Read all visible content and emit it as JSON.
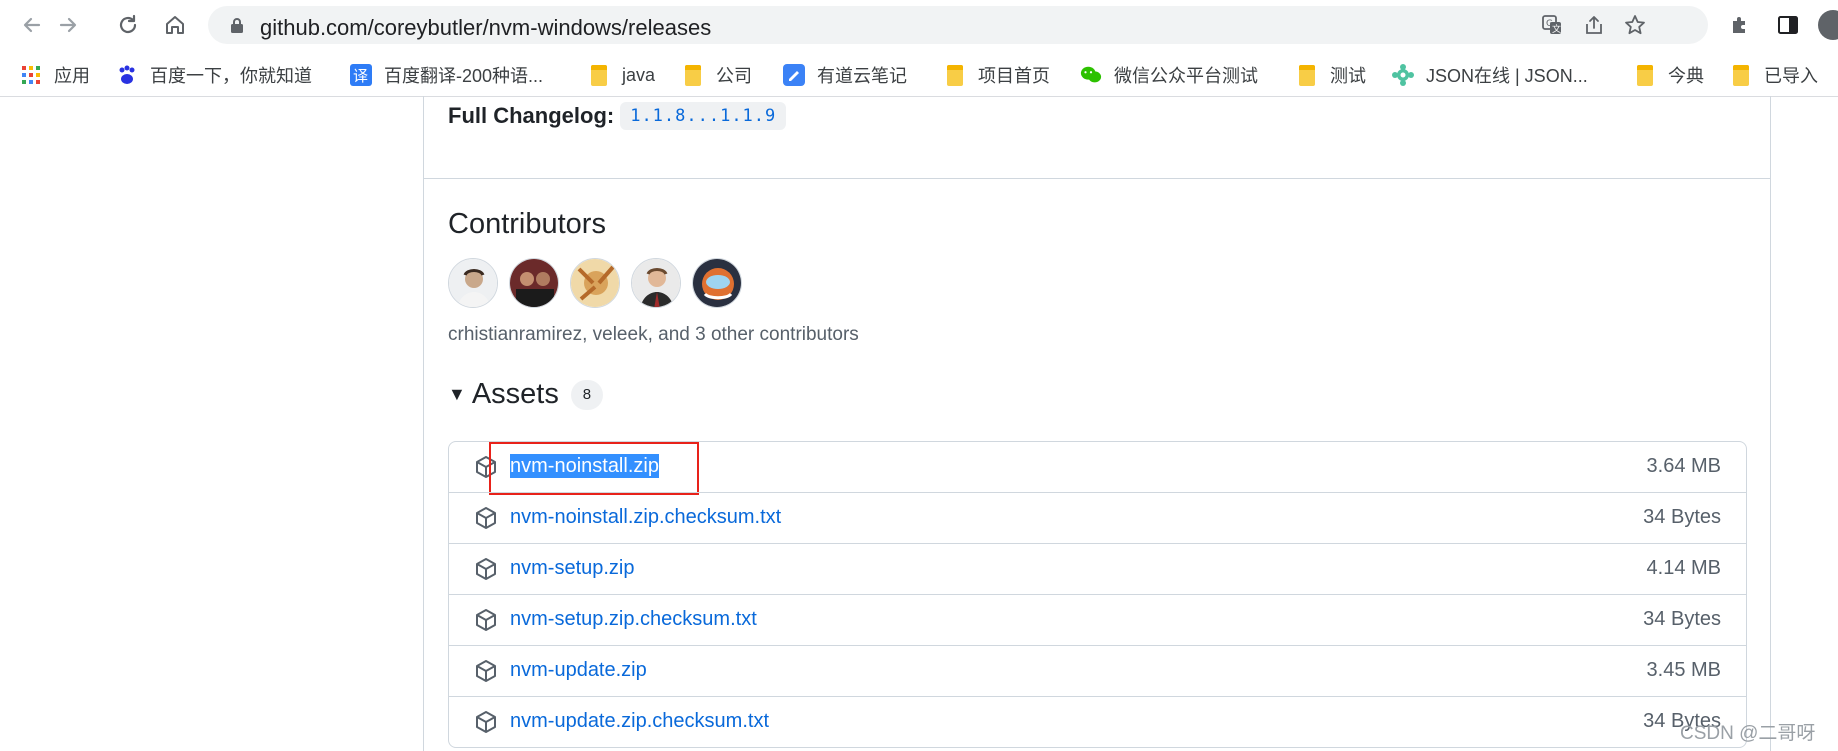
{
  "browser": {
    "url_host": "github.com",
    "url_path": "/coreybutler/nvm-windows/releases",
    "icons": {
      "back": "arrow-left-icon",
      "forward": "arrow-right-icon",
      "reload": "reload-icon",
      "home": "home-icon",
      "lock": "lock-icon",
      "translate": "translate-icon",
      "share": "share-icon",
      "bookmark": "star-icon",
      "extensions": "puzzle-icon",
      "sidepanel": "side-panel-icon"
    }
  },
  "bookmarks": [
    {
      "label": "应用",
      "icon": "apps-grid-icon"
    },
    {
      "label": "百度一下，你就知道",
      "icon": "baidu-paw-icon"
    },
    {
      "label": "百度翻译-200种语...",
      "icon": "translate-badge-icon"
    },
    {
      "label": "java",
      "icon": "folder-icon"
    },
    {
      "label": "公司",
      "icon": "folder-icon"
    },
    {
      "label": "有道云笔记",
      "icon": "note-icon"
    },
    {
      "label": "项目首页",
      "icon": "folder-icon"
    },
    {
      "label": "微信公众平台测试",
      "icon": "wechat-icon"
    },
    {
      "label": "测试",
      "icon": "folder-icon"
    },
    {
      "label": "JSON在线 | JSON...",
      "icon": "json-gear-icon"
    },
    {
      "label": "今典",
      "icon": "folder-icon"
    },
    {
      "label": "已导入",
      "icon": "folder-icon"
    }
  ],
  "release": {
    "changelog_label": "Full Changelog:",
    "changelog_range": "1.1.8...1.1.9",
    "contributors_title": "Contributors",
    "contributors_text": "crhistianramirez, veleek, and 3 other contributors",
    "assets_title": "Assets",
    "assets_count": "8",
    "assets": [
      {
        "name": "nvm-noinstall.zip",
        "size": "3.64 MB",
        "selected": true
      },
      {
        "name": "nvm-noinstall.zip.checksum.txt",
        "size": "34 Bytes"
      },
      {
        "name": "nvm-setup.zip",
        "size": "4.14 MB"
      },
      {
        "name": "nvm-setup.zip.checksum.txt",
        "size": "34 Bytes"
      },
      {
        "name": "nvm-update.zip",
        "size": "3.45 MB"
      },
      {
        "name": "nvm-update.zip.checksum.txt",
        "size": "34 Bytes"
      }
    ]
  },
  "watermark": "CSDN @二哥呀",
  "colors": {
    "link": "#0969da",
    "highlight_border": "#e8221a",
    "selection": "#3390ff"
  }
}
